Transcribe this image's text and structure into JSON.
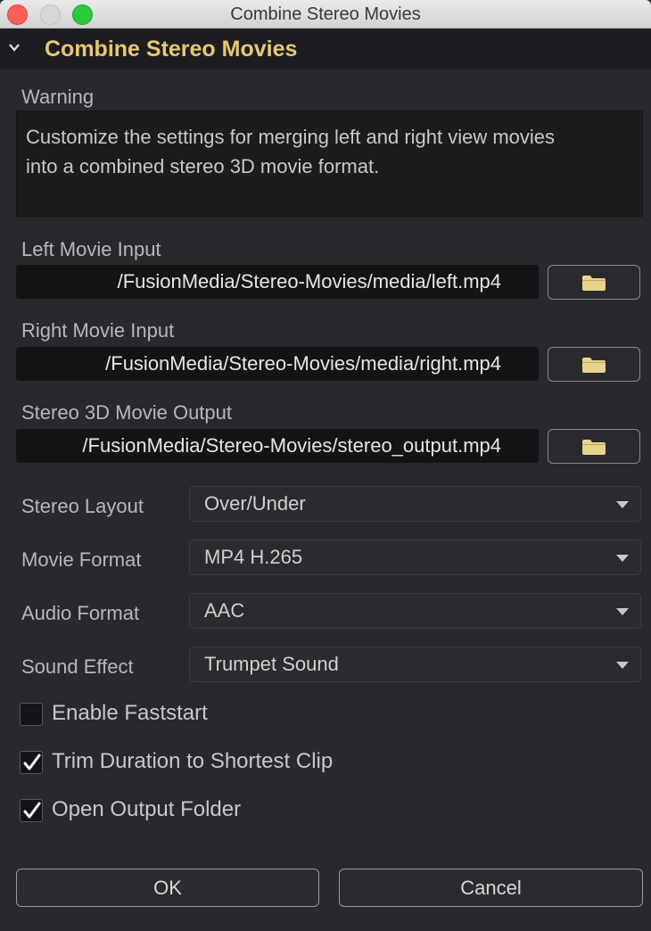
{
  "window": {
    "title": "Combine Stereo Movies"
  },
  "section": {
    "title": "Combine Stereo Movies",
    "expanded": true
  },
  "warning": {
    "label": "Warning",
    "text_line1": "Customize the settings for merging left and right view movies",
    "text_line2": "into a combined stereo 3D movie format."
  },
  "inputs": {
    "left": {
      "label": "Left Movie Input",
      "value": "/FusionMedia/Stereo-Movies/media/left.mp4"
    },
    "right": {
      "label": "Right Movie Input",
      "value": "/FusionMedia/Stereo-Movies/media/right.mp4"
    },
    "output": {
      "label": "Stereo 3D Movie Output",
      "value": "/FusionMedia/Stereo-Movies/stereo_output.mp4"
    }
  },
  "options": {
    "stereo_layout": {
      "label": "Stereo Layout",
      "value": "Over/Under"
    },
    "movie_format": {
      "label": "Movie Format",
      "value": "MP4 H.265"
    },
    "audio_format": {
      "label": "Audio Format",
      "value": "AAC"
    },
    "sound_effect": {
      "label": "Sound Effect",
      "value": "Trumpet Sound"
    }
  },
  "checkboxes": [
    {
      "label": "Enable Faststart",
      "checked": false
    },
    {
      "label": "Trim Duration to Shortest Clip",
      "checked": true
    },
    {
      "label": "Open Output Folder",
      "checked": true
    }
  ],
  "buttons": {
    "ok": "OK",
    "cancel": "Cancel"
  },
  "colors": {
    "background": "#28282e",
    "accent_title": "#e8c774",
    "folder_icon": "#e6d48a",
    "close": "#fc5f57",
    "maximize": "#28c83f"
  },
  "icons": {
    "folder": "folder-icon",
    "collapse": "chevron-down-icon",
    "dropdown": "caret-down-icon",
    "check": "checkmark-icon"
  }
}
